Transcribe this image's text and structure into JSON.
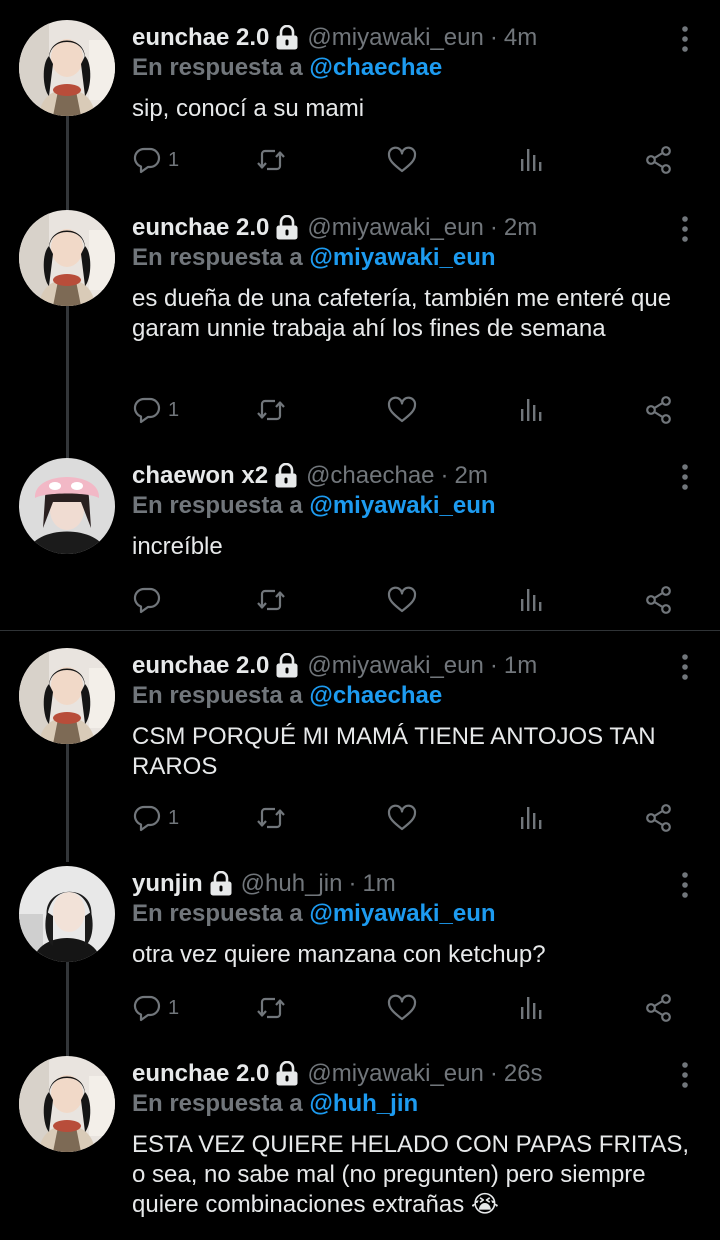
{
  "tweets": [
    {
      "name": "eunchae 2.0",
      "handle": "@miyawaki_eun",
      "sep": "·",
      "time": "4m",
      "reply_prefix": "En respuesta a",
      "reply_to": "@chaechae",
      "text": "sip, conocí a su mami",
      "replies": "1"
    },
    {
      "name": "eunchae 2.0",
      "handle": "@miyawaki_eun",
      "sep": "·",
      "time": "2m",
      "reply_prefix": "En respuesta a",
      "reply_to": "@miyawaki_eun",
      "text": "es dueña de una cafetería, también me enteré que garam unnie trabaja ahí los fines de semana",
      "replies": "1"
    },
    {
      "name": "chaewon x2",
      "handle": "@chaechae",
      "sep": "·",
      "time": "2m",
      "reply_prefix": "En respuesta a",
      "reply_to": "@miyawaki_eun",
      "text": "increíble",
      "replies": ""
    },
    {
      "name": "eunchae 2.0",
      "handle": "@miyawaki_eun",
      "sep": "·",
      "time": "1m",
      "reply_prefix": "En respuesta a",
      "reply_to": "@chaechae",
      "text": "CSM PORQUÉ MI MAMÁ TIENE ANTOJOS TAN RAROS",
      "replies": "1"
    },
    {
      "name": "yunjin",
      "handle": "@huh_jin",
      "sep": "·",
      "time": "1m",
      "reply_prefix": "En respuesta a",
      "reply_to": "@miyawaki_eun",
      "text": "otra vez quiere manzana con ketchup?",
      "replies": "1"
    },
    {
      "name": "eunchae 2.0",
      "handle": "@miyawaki_eun",
      "sep": "·",
      "time": "26s",
      "reply_prefix": "En respuesta a",
      "reply_to": "@huh_jin",
      "text": "ESTA VEZ QUIERE HELADO CON PAPAS FRITAS, o sea, no sabe mal (no pregunten) pero siempre quiere combinaciones extrañas 😭",
      "replies": ""
    }
  ],
  "icons": {
    "lock": "lock-icon",
    "more": "more-vertical-icon",
    "reply": "reply-icon",
    "retweet": "retweet-icon",
    "like": "heart-icon",
    "views": "views-icon",
    "share": "share-icon"
  },
  "colors": {
    "background": "#000000",
    "text": "#e7e9ea",
    "muted": "#71767b",
    "mention": "#1d9bf0",
    "thread_line": "#333639"
  }
}
